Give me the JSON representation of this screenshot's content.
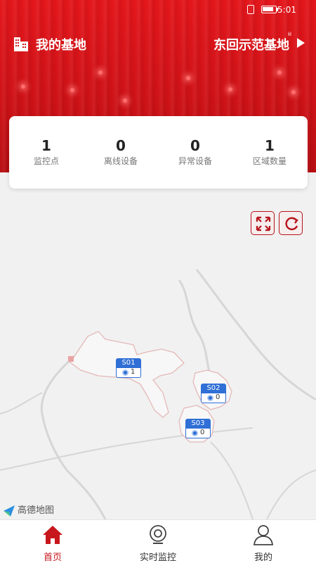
{
  "status_bar": {
    "time": "5:01"
  },
  "header": {
    "title": "我的基地",
    "base_name": "东回示范基地",
    "base_mark": "®"
  },
  "stats": [
    {
      "value": "1",
      "label": "监控点"
    },
    {
      "value": "0",
      "label": "离线设备"
    },
    {
      "value": "0",
      "label": "异常设备"
    },
    {
      "value": "1",
      "label": "区域数量"
    }
  ],
  "map": {
    "markers": [
      {
        "code": "S01",
        "count": "1"
      },
      {
        "code": "S02",
        "count": "0"
      },
      {
        "code": "S03",
        "count": "0"
      }
    ],
    "provider": "高德地图"
  },
  "nav": {
    "items": [
      {
        "label": "首页",
        "icon": "home-icon",
        "active": true
      },
      {
        "label": "实时监控",
        "icon": "camera-icon",
        "active": false
      },
      {
        "label": "我的",
        "icon": "user-icon",
        "active": false
      }
    ]
  },
  "colors": {
    "brand_red": "#c8161d",
    "marker_blue": "#2f6fd6"
  }
}
